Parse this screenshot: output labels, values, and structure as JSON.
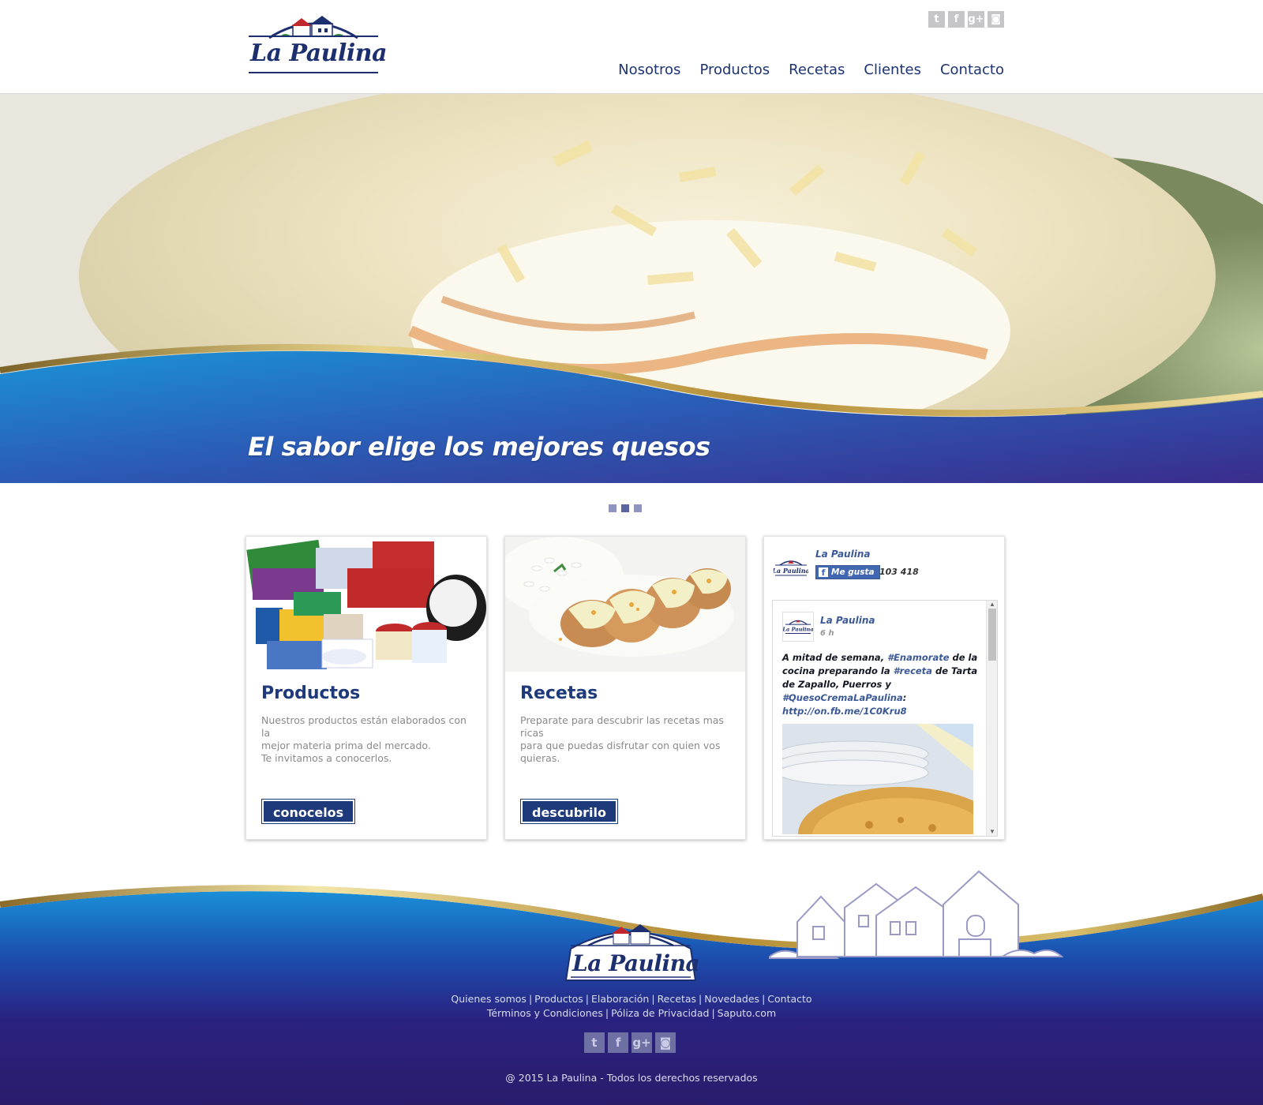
{
  "brand": {
    "name": "La Paulina"
  },
  "header": {
    "social": [
      {
        "icon": "twitter-icon",
        "glyph": "t"
      },
      {
        "icon": "facebook-icon",
        "glyph": "f"
      },
      {
        "icon": "google-plus-icon",
        "glyph": "g+"
      },
      {
        "icon": "instagram-icon",
        "glyph": "◙"
      }
    ],
    "nav": [
      "Nosotros",
      "Productos",
      "Recetas",
      "Clientes",
      "Contacto"
    ]
  },
  "hero": {
    "title": "El sabor elige los mejores quesos"
  },
  "slider": {
    "count": 3,
    "active": 2
  },
  "cards": {
    "productos": {
      "title": "Productos",
      "desc": [
        "Nuestros productos están elaborados con la",
        "mejor materia prima del mercado.",
        "Te invitamos a conocerlos."
      ],
      "button": "conocelos"
    },
    "recetas": {
      "title": "Recetas",
      "desc": [
        "Preparate para descubrir las recetas mas ricas",
        "para que puedas disfrutar con quien vos",
        "quieras."
      ],
      "button": "descubrilo"
    }
  },
  "facebook": {
    "page_name": "La Paulina",
    "like_label": "Me gusta",
    "like_count": "103 418",
    "post": {
      "author": "La Paulina",
      "time": "6 h",
      "text": {
        "t1": "A mitad de semana, ",
        "h1": "#Enamorate",
        "t2": " de la cocina preparando la ",
        "h2": "#receta",
        "t3": " de Tarta de Zapallo, Puerros y ",
        "h3": "#QuesoCremaLaPaulina",
        "t4": ": ",
        "link": "http://on.fb.me/1C0Kru8"
      }
    }
  },
  "footer": {
    "links_row1": [
      "Quienes somos",
      "Productos",
      "Elaboración",
      "Recetas",
      "Novedades",
      "Contacto"
    ],
    "links_row2": [
      "Términos y Condiciones",
      "Póliza de Privacidad",
      "Saputo.com"
    ],
    "copyright": "@ 2015 La Paulina - Todos los derechos reservados"
  },
  "colors": {
    "brand_blue": "#1f3a7b",
    "gold": "#c9a23c",
    "footer_purple": "#2a1c6b"
  }
}
